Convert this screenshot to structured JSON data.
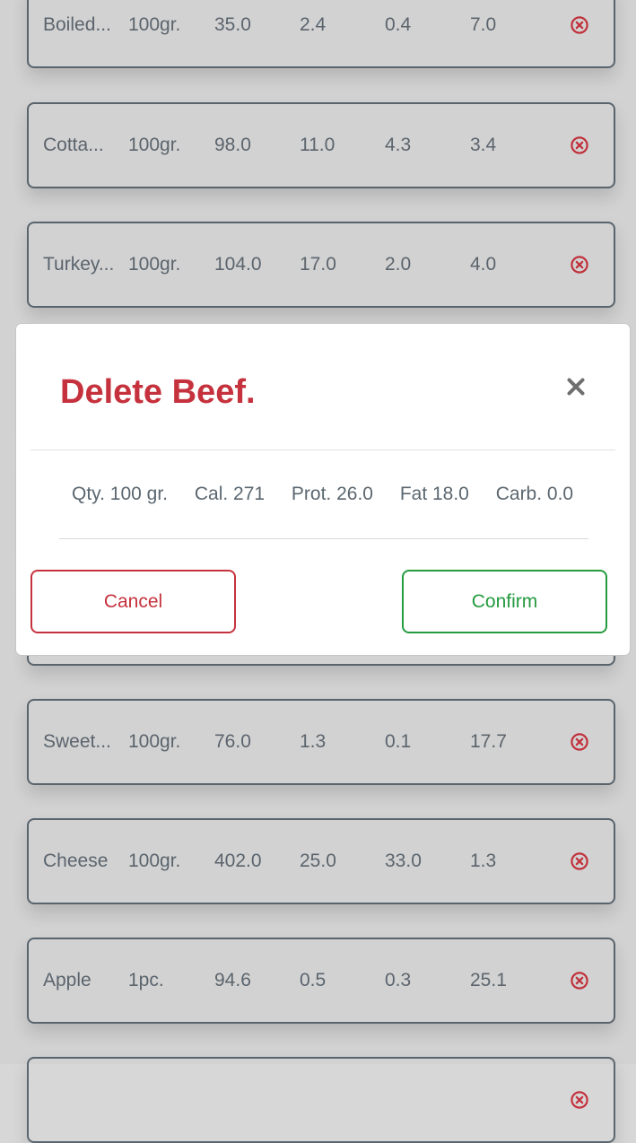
{
  "foods": [
    {
      "name": "Boiled...",
      "qty": "100gr.",
      "cal": "35.0",
      "prot": "2.4",
      "fat": "0.4",
      "carb": "7.0",
      "delete_icon": "circle-x-icon"
    },
    {
      "name": "Cotta...",
      "qty": "100gr.",
      "cal": "98.0",
      "prot": "11.0",
      "fat": "4.3",
      "carb": "3.4",
      "delete_icon": "circle-x-icon"
    },
    {
      "name": "Turkey...",
      "qty": "100gr.",
      "cal": "104.0",
      "prot": "17.0",
      "fat": "2.0",
      "carb": "4.0",
      "delete_icon": "circle-x-icon"
    },
    {
      "name": "",
      "qty": "",
      "cal": "",
      "prot": "",
      "fat": "",
      "carb": "",
      "delete_icon": "circle-x-icon"
    },
    {
      "name": "",
      "qty": "",
      "cal": "",
      "prot": "",
      "fat": "",
      "carb": "",
      "delete_icon": "circle-x-icon"
    },
    {
      "name": "",
      "qty": "",
      "cal": "",
      "prot": "",
      "fat": "",
      "carb": "",
      "delete_icon": "circle-x-icon"
    },
    {
      "name": "Sweet...",
      "qty": "100gr.",
      "cal": "76.0",
      "prot": "1.3",
      "fat": "0.1",
      "carb": "17.7",
      "delete_icon": "circle-x-icon"
    },
    {
      "name": "Cheese",
      "qty": "100gr.",
      "cal": "402.0",
      "prot": "25.0",
      "fat": "33.0",
      "carb": "1.3",
      "delete_icon": "circle-x-icon"
    },
    {
      "name": "Apple",
      "qty": "1pc.",
      "cal": "94.6",
      "prot": "0.5",
      "fat": "0.3",
      "carb": "25.1",
      "delete_icon": "circle-x-icon"
    },
    {
      "name": "",
      "qty": "",
      "cal": "",
      "prot": "",
      "fat": "",
      "carb": "",
      "delete_icon": "circle-x-icon"
    }
  ],
  "modal": {
    "title": "Delete Beef.",
    "close_icon": "close-icon",
    "stats": {
      "qty": "Qty. 100 gr.",
      "cal": "Cal. 271",
      "prot": "Prot. 26.0",
      "fat": "Fat 18.0",
      "carb": "Carb. 0.0"
    },
    "cancel_label": "Cancel",
    "confirm_label": "Confirm"
  },
  "colors": {
    "background": "#d7d7d7",
    "text": "#5d6770",
    "row_border": "#5b6770",
    "danger": "#c5323d",
    "success": "#259b3f",
    "modal_background": "#ffffff"
  }
}
